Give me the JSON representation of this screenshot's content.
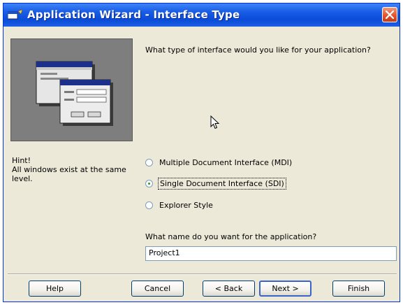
{
  "window": {
    "title": "Application Wizard - Interface Type"
  },
  "main": {
    "question": "What type of interface would you like for your application?",
    "hint_title": "Hint!",
    "hint_line1": "All windows exist at the same",
    "hint_line2": "level.",
    "interface_options": [
      {
        "label": "Multiple Document Interface (MDI)",
        "selected": false
      },
      {
        "label": "Single Document Interface (SDI)",
        "selected": true
      },
      {
        "label": "Explorer Style",
        "selected": false
      }
    ],
    "name_label": "What name do you want for the application?",
    "name_value": "Project1"
  },
  "buttons": {
    "help": "Help",
    "cancel": "Cancel",
    "back": "< Back",
    "next": "Next >",
    "finish": "Finish"
  },
  "colors": {
    "titlebar": "#0a4bd8",
    "dialog_bg": "#ece9d8",
    "close_button": "#e0502a",
    "image_panel": "#7e7e7e"
  }
}
